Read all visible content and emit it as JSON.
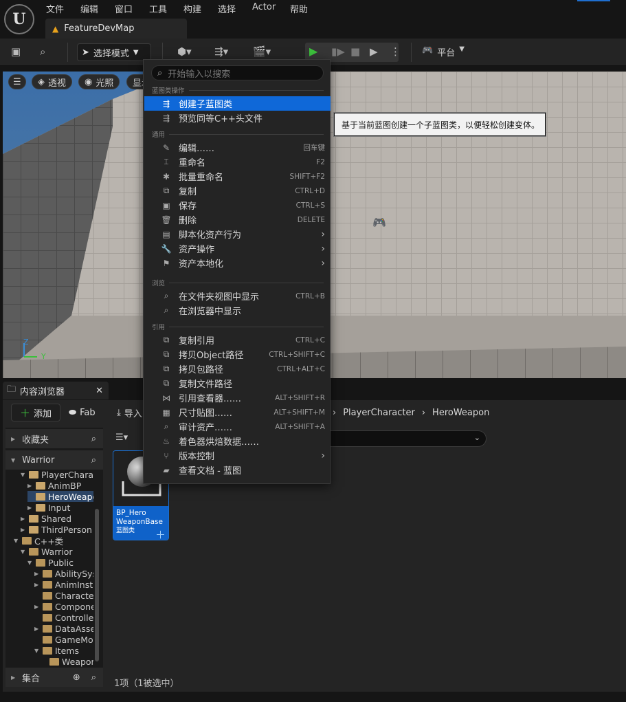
{
  "menubar": {
    "items": [
      "文件",
      "编辑",
      "窗口",
      "工具",
      "构建",
      "选择",
      "Actor",
      "帮助"
    ]
  },
  "logo": "U",
  "doc_tab": {
    "title": "FeatureDevMap"
  },
  "toolbar": {
    "mode_label": "选择模式",
    "platform_label": "平台"
  },
  "viewport": {
    "perspective": "透视",
    "lighting": "光照",
    "show": "显示",
    "axis_y": "Y",
    "axis_z": "Z"
  },
  "content_browser": {
    "tab_title": "内容浏览器",
    "add_label": "添加",
    "fab_label": "Fab",
    "import_label": "导入",
    "breadcrumb": [
      "PlayerCharacter",
      "HeroWeapon"
    ],
    "favorites_label": "收藏夹",
    "project_label": "Warrior",
    "collections_label": "集合",
    "tree": [
      {
        "label": "PlayerCharacter",
        "indent": 2,
        "open": true
      },
      {
        "label": "AnimBP",
        "indent": 3,
        "open": false
      },
      {
        "label": "HeroWeapon",
        "indent": 3,
        "open": null,
        "selected": true
      },
      {
        "label": "Input",
        "indent": 3,
        "open": false
      },
      {
        "label": "Shared",
        "indent": 2,
        "open": false
      },
      {
        "label": "ThirdPerson",
        "indent": 2,
        "open": false
      },
      {
        "label": "C++类",
        "indent": 1,
        "open": true,
        "cpp": true
      },
      {
        "label": "Warrior",
        "indent": 2,
        "open": true,
        "cpp": true
      },
      {
        "label": "Public",
        "indent": 3,
        "open": true,
        "cpp": true
      },
      {
        "label": "AbilitySystem",
        "indent": 4,
        "open": false,
        "cpp": true
      },
      {
        "label": "AnimInstances",
        "indent": 4,
        "open": false,
        "cpp": true
      },
      {
        "label": "Characters",
        "indent": 4,
        "open": null,
        "cpp": true
      },
      {
        "label": "Components",
        "indent": 4,
        "open": false,
        "cpp": true
      },
      {
        "label": "Controllers",
        "indent": 4,
        "open": null,
        "cpp": true
      },
      {
        "label": "DataAssets",
        "indent": 4,
        "open": false,
        "cpp": true
      },
      {
        "label": "GameModes",
        "indent": 4,
        "open": null,
        "cpp": true
      },
      {
        "label": "Items",
        "indent": 4,
        "open": true,
        "cpp": true
      },
      {
        "label": "Weapons",
        "indent": 5,
        "open": null,
        "cpp": true
      }
    ],
    "asset": {
      "name_line1": "BP_Hero",
      "name_line2": "WeaponBase",
      "type": "蓝图类"
    },
    "status": "1项（1被选中）"
  },
  "context_menu": {
    "search_placeholder": "开始输入以搜索",
    "sections": [
      {
        "title": "蓝图类操作",
        "items": [
          {
            "label": "创建子蓝图类",
            "shortcut": "",
            "icon": "blueprint-child-icon",
            "glyph": "⇶",
            "highlighted": true
          },
          {
            "label": "预览同等C++头文件",
            "shortcut": "",
            "icon": "cpp-header-icon",
            "glyph": "⇶"
          }
        ]
      },
      {
        "title": "通用",
        "items": [
          {
            "label": "编辑……",
            "shortcut": "回车键",
            "icon": "edit-icon",
            "glyph": "✎"
          },
          {
            "label": "重命名",
            "shortcut": "F2",
            "icon": "rename-icon",
            "glyph": "⌶"
          },
          {
            "label": "批量重命名",
            "shortcut": "SHIFT+F2",
            "icon": "bulk-rename-icon",
            "glyph": "✱"
          },
          {
            "label": "复制",
            "shortcut": "CTRL+D",
            "icon": "duplicate-icon",
            "glyph": "⧉"
          },
          {
            "label": "保存",
            "shortcut": "CTRL+S",
            "icon": "save-icon",
            "glyph": "▣"
          },
          {
            "label": "删除",
            "shortcut": "DELETE",
            "icon": "delete-icon",
            "glyph": "🗑"
          },
          {
            "label": "脚本化资产行为",
            "shortcut": "",
            "icon": "script-icon",
            "glyph": "▤",
            "submenu": true
          },
          {
            "label": "资产操作",
            "shortcut": "",
            "icon": "wrench-icon",
            "glyph": "🔧",
            "submenu": true
          },
          {
            "label": "资产本地化",
            "shortcut": "",
            "icon": "flag-icon",
            "glyph": "⚑",
            "submenu": true
          }
        ]
      },
      {
        "title": "浏览",
        "items": [
          {
            "label": "在文件夹视图中显示",
            "shortcut": "CTRL+B",
            "icon": "folder-search-icon",
            "glyph": "⌕"
          },
          {
            "label": "在浏览器中显示",
            "shortcut": "",
            "icon": "explorer-icon",
            "glyph": "⌕"
          }
        ]
      },
      {
        "title": "引用",
        "items": [
          {
            "label": "复制引用",
            "shortcut": "CTRL+C",
            "icon": "copy-reference-icon",
            "glyph": "⧉"
          },
          {
            "label": "拷贝Object路径",
            "shortcut": "CTRL+SHIFT+C",
            "icon": "copy-object-path-icon",
            "glyph": "⧉"
          },
          {
            "label": "拷贝包路径",
            "shortcut": "CTRL+ALT+C",
            "icon": "copy-package-path-icon",
            "glyph": "⧉"
          },
          {
            "label": "复制文件路径",
            "shortcut": "",
            "icon": "copy-file-path-icon",
            "glyph": "⧉"
          },
          {
            "label": "引用查看器……",
            "shortcut": "ALT+SHIFT+R",
            "icon": "reference-viewer-icon",
            "glyph": "⋈"
          },
          {
            "label": "尺寸贴图……",
            "shortcut": "ALT+SHIFT+M",
            "icon": "size-map-icon",
            "glyph": "▦"
          },
          {
            "label": "审计资产……",
            "shortcut": "ALT+SHIFT+A",
            "icon": "audit-icon",
            "glyph": "⌕"
          },
          {
            "label": "着色器烘焙数据……",
            "shortcut": "",
            "icon": "shader-icon",
            "glyph": "♨"
          },
          {
            "label": "版本控制",
            "shortcut": "",
            "icon": "version-control-icon",
            "glyph": "⑂",
            "submenu": true
          },
          {
            "label": "查看文档 - 蓝图",
            "shortcut": "",
            "icon": "docs-icon",
            "glyph": "▰"
          }
        ]
      }
    ]
  },
  "tooltip": "基于当前蓝图创建一个子蓝图类，以便轻松创建变体。"
}
